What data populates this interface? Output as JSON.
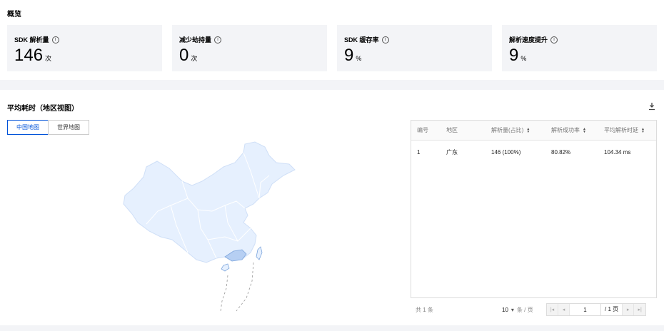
{
  "overview": {
    "title": "概览"
  },
  "stats": [
    {
      "label": "SDK 解析量",
      "value": "146",
      "unit": "次"
    },
    {
      "label": "减少劫持量",
      "value": "0",
      "unit": "次"
    },
    {
      "label": "SDK 缓存率",
      "value": "9",
      "unit": "%"
    },
    {
      "label": "解析速度提升",
      "value": "9",
      "unit": "%"
    }
  ],
  "latency": {
    "title": "平均耗时（地区视图）",
    "tabs": [
      "中国地图",
      "世界地图"
    ],
    "active_tab": 0
  },
  "table": {
    "headers": [
      "编号",
      "地区",
      "解析量(占比)",
      "解析成功率",
      "平均解析时延"
    ],
    "rows": [
      [
        "1",
        "广东",
        "146 (100%)",
        "80.82%",
        "104.34 ms"
      ]
    ]
  },
  "pagination": {
    "total_text": "共 1 条",
    "page_size": "10",
    "page_size_unit": "条 / 页",
    "current_page": "1",
    "total_pages_text": "/ 1 页"
  },
  "colors": {
    "accent": "#0052d9",
    "map_fill": "#e6f0fe",
    "highlight": "#b6cff3"
  }
}
